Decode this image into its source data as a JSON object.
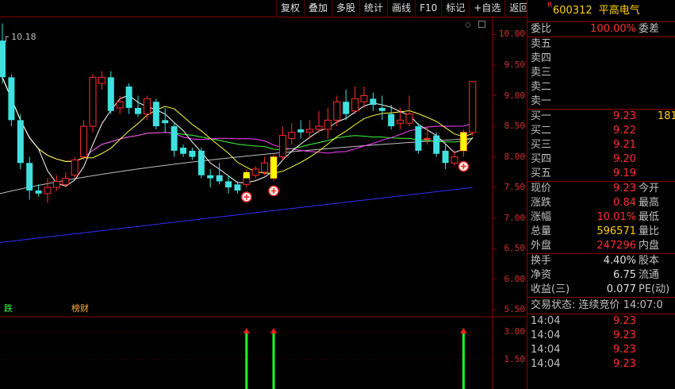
{
  "toolbar": [
    "复权",
    "叠加",
    "多股",
    "统计",
    "画线",
    "F10",
    "标记",
    "+自选",
    "返回"
  ],
  "chart": {
    "high_marker": "10.18",
    "price_axis": [
      "10.00",
      "9.50",
      "9.00",
      "8.50",
      "8.00",
      "7.50",
      "7.00",
      "6.50",
      "6.00",
      "5.50"
    ],
    "indicator_axis": [
      "3.00",
      "1.50"
    ],
    "labels": {
      "left": "跌",
      "mid": "榜财"
    },
    "colors": {
      "up": "#ff3030",
      "down": "#40e0e0",
      "signal": "#ffff00",
      "ma5": "#ffffff",
      "ma10": "#ffff40",
      "ma20": "#ff40ff",
      "ma30": "#40ff40",
      "ma60": "#c0c0c0",
      "ma120": "#3030ff"
    }
  },
  "chart_data": {
    "type": "candlestick",
    "ylim": [
      5.4,
      10.2
    ],
    "candles": [
      {
        "o": 9.9,
        "c": 9.3,
        "h": 10.18,
        "l": 9.2
      },
      {
        "o": 9.3,
        "c": 8.6,
        "h": 9.35,
        "l": 8.5
      },
      {
        "o": 8.6,
        "c": 7.9,
        "h": 8.7,
        "l": 7.8
      },
      {
        "o": 7.9,
        "c": 7.45,
        "h": 8.0,
        "l": 7.3
      },
      {
        "o": 7.45,
        "c": 7.4,
        "h": 7.55,
        "l": 7.35
      },
      {
        "o": 7.4,
        "c": 7.5,
        "h": 7.65,
        "l": 7.25
      },
      {
        "o": 7.5,
        "c": 7.6,
        "h": 7.7,
        "l": 7.45
      },
      {
        "o": 7.55,
        "c": 7.65,
        "h": 7.75,
        "l": 7.5
      },
      {
        "o": 7.7,
        "c": 7.95,
        "h": 8.0,
        "l": 7.65
      },
      {
        "o": 8.0,
        "c": 8.5,
        "h": 8.6,
        "l": 7.95
      },
      {
        "o": 8.5,
        "c": 9.3,
        "h": 9.35,
        "l": 8.4
      },
      {
        "o": 9.2,
        "c": 9.3,
        "h": 9.4,
        "l": 9.1
      },
      {
        "o": 9.3,
        "c": 8.75,
        "h": 9.4,
        "l": 8.7
      },
      {
        "o": 8.8,
        "c": 8.9,
        "h": 9.0,
        "l": 8.7
      },
      {
        "o": 9.15,
        "c": 8.8,
        "h": 9.2,
        "l": 8.7
      },
      {
        "o": 8.8,
        "c": 8.7,
        "h": 9.0,
        "l": 8.65
      },
      {
        "o": 8.7,
        "c": 8.95,
        "h": 9.0,
        "l": 8.6
      },
      {
        "o": 8.9,
        "c": 8.5,
        "h": 8.95,
        "l": 8.45
      },
      {
        "o": 8.6,
        "c": 8.55,
        "h": 8.8,
        "l": 8.4
      },
      {
        "o": 8.5,
        "c": 8.1,
        "h": 8.55,
        "l": 8.0
      },
      {
        "o": 8.15,
        "c": 8.05,
        "h": 8.2,
        "l": 8.0
      },
      {
        "o": 8.1,
        "c": 8.0,
        "h": 8.15,
        "l": 7.95
      },
      {
        "o": 8.1,
        "c": 7.7,
        "h": 8.15,
        "l": 7.65
      },
      {
        "o": 7.7,
        "c": 7.65,
        "h": 7.8,
        "l": 7.5
      },
      {
        "o": 7.7,
        "c": 7.6,
        "h": 7.9,
        "l": 7.55
      },
      {
        "o": 7.6,
        "c": 7.5,
        "h": 7.7,
        "l": 7.4
      },
      {
        "o": 7.55,
        "c": 7.45,
        "h": 7.6,
        "l": 7.4
      },
      {
        "o": 7.55,
        "c": 7.7,
        "h": 7.8,
        "l": 7.5
      },
      {
        "o": 7.7,
        "c": 7.8,
        "h": 7.85,
        "l": 7.65
      },
      {
        "o": 7.75,
        "c": 7.9,
        "h": 8.0,
        "l": 7.7
      },
      {
        "o": 7.65,
        "c": 8.0,
        "h": 8.05,
        "l": 7.6
      },
      {
        "o": 8.0,
        "c": 8.35,
        "h": 8.5,
        "l": 7.95
      },
      {
        "o": 8.3,
        "c": 8.4,
        "h": 8.55,
        "l": 8.2
      },
      {
        "o": 8.45,
        "c": 8.4,
        "h": 8.6,
        "l": 8.3
      },
      {
        "o": 8.4,
        "c": 8.45,
        "h": 8.6,
        "l": 8.3
      },
      {
        "o": 8.45,
        "c": 8.5,
        "h": 8.75,
        "l": 8.4
      },
      {
        "o": 8.45,
        "c": 8.6,
        "h": 8.8,
        "l": 8.3
      },
      {
        "o": 8.6,
        "c": 8.9,
        "h": 9.0,
        "l": 8.5
      },
      {
        "o": 8.9,
        "c": 8.7,
        "h": 9.1,
        "l": 8.6
      },
      {
        "o": 8.75,
        "c": 8.95,
        "h": 9.15,
        "l": 8.7
      },
      {
        "o": 8.9,
        "c": 9.0,
        "h": 9.15,
        "l": 8.8
      },
      {
        "o": 8.95,
        "c": 8.85,
        "h": 9.05,
        "l": 8.75
      },
      {
        "o": 8.8,
        "c": 8.75,
        "h": 9.0,
        "l": 8.6
      },
      {
        "o": 8.7,
        "c": 8.5,
        "h": 8.85,
        "l": 8.45
      },
      {
        "o": 8.55,
        "c": 8.6,
        "h": 8.8,
        "l": 8.45
      },
      {
        "o": 8.55,
        "c": 8.7,
        "h": 9.0,
        "l": 8.5
      },
      {
        "o": 8.5,
        "c": 8.1,
        "h": 8.55,
        "l": 8.05
      },
      {
        "o": 8.3,
        "c": 8.3,
        "h": 8.5,
        "l": 8.2
      },
      {
        "o": 8.35,
        "c": 8.05,
        "h": 8.4,
        "l": 8.0
      },
      {
        "o": 8.1,
        "c": 7.9,
        "h": 8.2,
        "l": 7.8
      },
      {
        "o": 7.9,
        "c": 8.0,
        "h": 8.1,
        "l": 7.85
      },
      {
        "o": 8.1,
        "c": 8.4,
        "h": 8.45,
        "l": 8.0
      },
      {
        "o": 8.4,
        "c": 9.23,
        "h": 9.23,
        "l": 8.35
      }
    ],
    "signals": [
      {
        "index": 27,
        "low": 7.65,
        "high": 7.75
      },
      {
        "index": 30,
        "low": 7.65,
        "high": 8.0
      },
      {
        "index": 51,
        "low": 8.1,
        "high": 8.4
      }
    ],
    "buy_markers": [
      27,
      30,
      51
    ],
    "indicator": {
      "bars": [
        {
          "index": 27,
          "value": 3.0
        },
        {
          "index": 30,
          "value": 3.0
        },
        {
          "index": 51,
          "value": 3.0
        }
      ],
      "ylim": [
        0,
        3.6
      ]
    },
    "ma_lines": [
      {
        "name": "MA5",
        "color": "#ffffff"
      },
      {
        "name": "MA10",
        "color": "#ffff40"
      },
      {
        "name": "MA20",
        "color": "#ff40ff"
      },
      {
        "name": "MA30",
        "color": "#40ff40"
      },
      {
        "name": "MA60",
        "color": "#c0c0c0",
        "values_start": 7.4,
        "values_end": 8.3
      },
      {
        "name": "MA120",
        "color": "#3030ff",
        "values_start": 6.6,
        "values_end": 7.5
      }
    ]
  },
  "panel": {
    "stock_marker": "R",
    "code": "600312",
    "name": "平高电气",
    "wei_bi_label": "委比",
    "wei_bi_value": "100.00%",
    "wei_cha_label": "委差",
    "asks": [
      {
        "label": "卖五",
        "price": "",
        "vol": ""
      },
      {
        "label": "卖四",
        "price": "",
        "vol": ""
      },
      {
        "label": "卖三",
        "price": "",
        "vol": ""
      },
      {
        "label": "卖二",
        "price": "",
        "vol": ""
      },
      {
        "label": "卖一",
        "price": "",
        "vol": ""
      }
    ],
    "bids": [
      {
        "label": "买一",
        "price": "9.23",
        "vol": "181"
      },
      {
        "label": "买二",
        "price": "9.22",
        "vol": ""
      },
      {
        "label": "买三",
        "price": "9.21",
        "vol": ""
      },
      {
        "label": "买四",
        "price": "9.20",
        "vol": ""
      },
      {
        "label": "买五",
        "price": "9.19",
        "vol": ""
      }
    ],
    "stats": [
      {
        "label": "现价",
        "value": "9.23",
        "label2": "今开",
        "cls": "red"
      },
      {
        "label": "涨跌",
        "value": "0.84",
        "label2": "最高",
        "cls": "red"
      },
      {
        "label": "涨幅",
        "value": "10.01%",
        "label2": "最低",
        "cls": "red"
      },
      {
        "label": "总量",
        "value": "596571",
        "label2": "量比",
        "cls": "yellow"
      },
      {
        "label": "外盘",
        "value": "247296",
        "label2": "内盘",
        "cls": "red"
      }
    ],
    "stats2": [
      {
        "label": "换手",
        "value": "4.40%",
        "label2": "股本",
        "cls": "white"
      },
      {
        "label": "净资",
        "value": "6.75",
        "label2": "流通",
        "cls": "white"
      },
      {
        "label": "收益(三)",
        "value": "0.077",
        "label2": "PE(动)",
        "cls": "white"
      }
    ],
    "status_label": "交易状态:",
    "status_value": "连续竞价",
    "status_time": "14:07:0",
    "ticks": [
      {
        "time": "14:04",
        "price": "9.23"
      },
      {
        "time": "14:04",
        "price": "9.23"
      },
      {
        "time": "14:04",
        "price": "9.23"
      },
      {
        "time": "14:04",
        "price": "9.23"
      }
    ]
  }
}
